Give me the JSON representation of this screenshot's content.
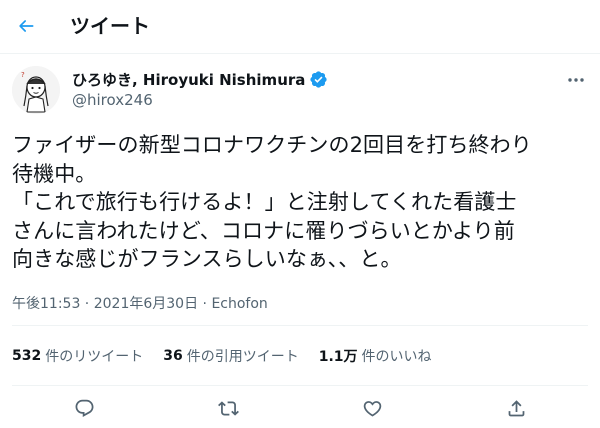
{
  "header": {
    "title": "ツイート",
    "back_icon": "arrow-left-icon"
  },
  "author": {
    "display_name": "ひろゆき, Hiroyuki Nishimura",
    "handle": "@hirox246",
    "verified_icon": "verified-badge-icon",
    "avatar_icon": "avatar-illustration"
  },
  "more_icon": "more-horizontal-icon",
  "tweet": {
    "text": "ファイザーの新型コロナワクチンの2回目を打ち終わり\n待機中。\n「これで旅行も行けるよ！」と注射してくれた看護士\nさんに言われたけど、コロナに罹りづらいとかより前\n向きな感じがフランスらしいなぁ、、と。"
  },
  "meta": {
    "time": "午後11:53",
    "sep1": " · ",
    "date": "2021年6月30日",
    "sep2": " · ",
    "source": "Echofon"
  },
  "stats": [
    {
      "num": "532",
      "label": "件のリツイート"
    },
    {
      "num": "36",
      "label": "件の引用ツイート"
    },
    {
      "num": "1.1万",
      "label": "件のいいね"
    }
  ],
  "actions": {
    "reply": "reply-icon",
    "retweet": "retweet-icon",
    "like": "like-heart-icon",
    "share": "share-icon"
  },
  "colors": {
    "accent": "#1d9bf0",
    "text": "#0f1419",
    "secondary": "#536471",
    "divider": "#eff3f4"
  }
}
